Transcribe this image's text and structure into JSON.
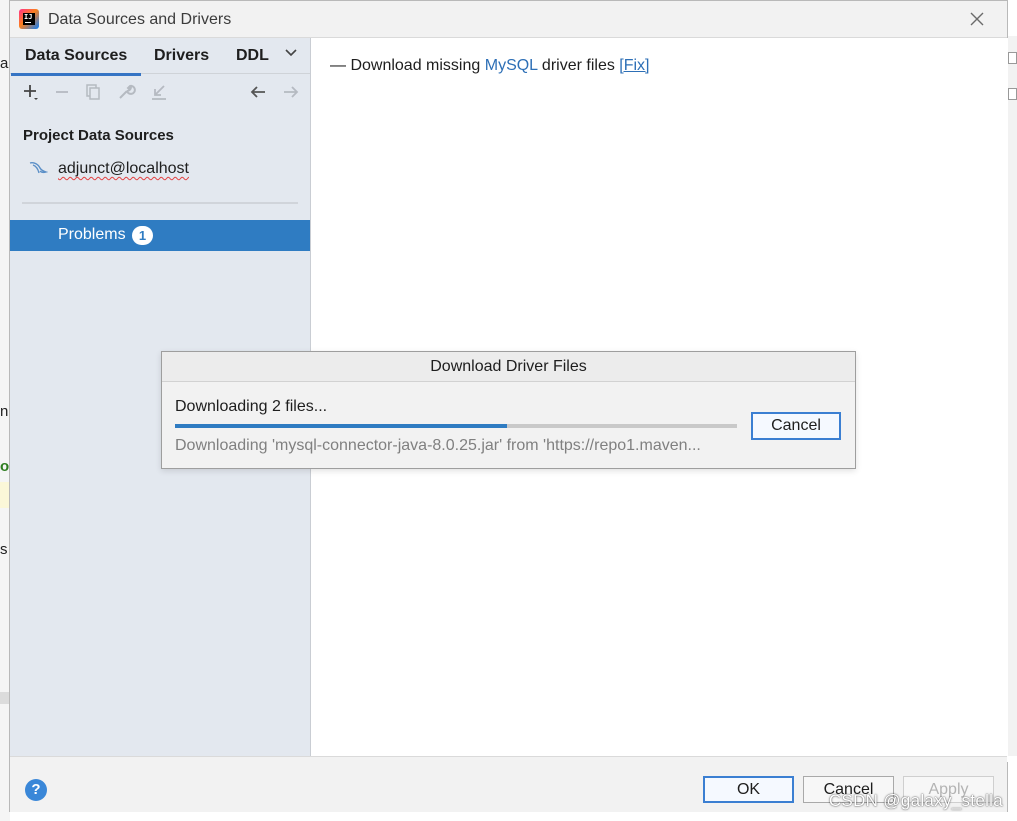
{
  "window": {
    "title": "Data Sources and Drivers",
    "close_icon": "close-icon"
  },
  "background_ide": {
    "fragments": [
      "ac",
      "n",
      "o",
      "s"
    ]
  },
  "left_panel": {
    "tabs": [
      {
        "label": "Data Sources",
        "active": true
      },
      {
        "label": "Drivers",
        "active": false
      },
      {
        "label": "DDL Mappings",
        "active": false
      }
    ],
    "tabs_more_icon": "chevron-down-icon",
    "toolbar_icons": [
      "add-icon",
      "remove-icon",
      "duplicate-icon",
      "wrench-icon",
      "import-icon",
      "back-arrow-icon",
      "forward-arrow-icon"
    ],
    "section_title": "Project Data Sources",
    "data_sources": [
      {
        "label": "adjunct@localhost",
        "icon": "mysql-icon"
      }
    ],
    "problems": {
      "label": "Problems",
      "count": "1"
    }
  },
  "content": {
    "notice_prefix": "— Download missing ",
    "notice_link": "MySQL",
    "notice_mid": " driver files ",
    "notice_fix": "[Fix]"
  },
  "download_modal": {
    "title": "Download Driver Files",
    "message": "Downloading 2 files...",
    "progress": 0.59,
    "detail": "Downloading 'mysql-connector-java-8.0.25.jar' from 'https://repo1.maven...",
    "cancel_label": "Cancel"
  },
  "bottom": {
    "help_label": "?",
    "ok_label": "OK",
    "cancel_label": "Cancel",
    "apply_label": "Apply"
  },
  "watermark": "CSDN @galaxy_stella",
  "colors": {
    "accent": "#2f7cc2",
    "link": "#2d6fb6",
    "left_panel_bg": "#e3e8ef"
  }
}
